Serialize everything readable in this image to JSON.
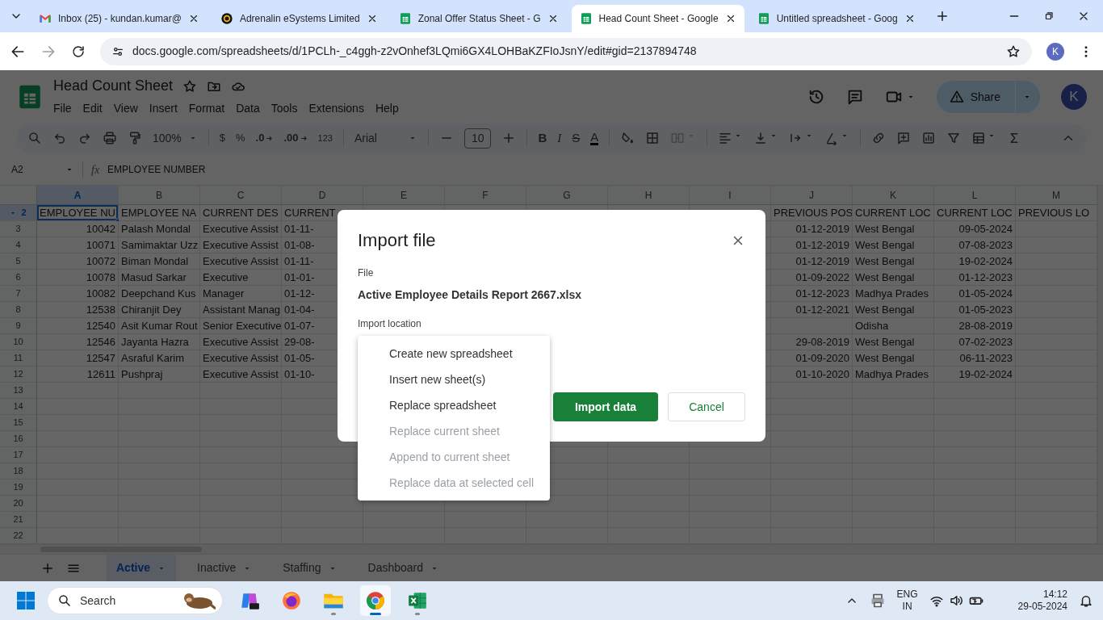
{
  "browser": {
    "tabs": [
      {
        "title": "Inbox (25) - kundan.kumar@",
        "kind": "mail",
        "selected": false
      },
      {
        "title": "Adrenalin eSystems Limited",
        "kind": "site",
        "selected": false
      },
      {
        "title": "Zonal Offer Status Sheet - G",
        "kind": "sheet",
        "selected": false
      },
      {
        "title": "Head Count Sheet - Google",
        "kind": "sheet",
        "selected": true
      },
      {
        "title": "Untitled spreadsheet - Goog",
        "kind": "sheet",
        "selected": false
      }
    ],
    "address": "docs.google.com/spreadsheets/d/1PCLh-_c4ggh-z2vOnhef3LQmi6GX4LOHBaKZFIoJsnY/edit#gid=2137894748",
    "profile_initial": "K"
  },
  "app": {
    "title": "Head Count Sheet",
    "menus": [
      "File",
      "Edit",
      "View",
      "Insert",
      "Format",
      "Data",
      "Tools",
      "Extensions",
      "Help"
    ],
    "share": "Share",
    "account_initial": "K"
  },
  "toolbar": {
    "zoom": "100%",
    "currency": "$",
    "percent": "%",
    "decimal_decrease": ".0",
    "decimal_increase": ".00",
    "number_format": "123",
    "font": "Arial",
    "font_size": "10",
    "bold": "B",
    "italic": "I",
    "strikethrough": "S",
    "text_color": "A"
  },
  "formula_bar": {
    "cell": "A2",
    "fx": "fx",
    "content": "EMPLOYEE NUMBER"
  },
  "sheet": {
    "columns": [
      {
        "letter": "A",
        "kind": "number",
        "selected": true
      },
      {
        "letter": "B",
        "kind": "text",
        "selected": false
      },
      {
        "letter": "C",
        "kind": "text",
        "selected": false
      },
      {
        "letter": "D",
        "kind": "text",
        "selected": false
      },
      {
        "letter": "E",
        "kind": "text",
        "selected": false
      },
      {
        "letter": "F",
        "kind": "text",
        "selected": false
      },
      {
        "letter": "G",
        "kind": "text",
        "selected": false
      },
      {
        "letter": "H",
        "kind": "text",
        "selected": false
      },
      {
        "letter": "I",
        "kind": "text",
        "selected": false
      },
      {
        "letter": "J",
        "kind": "number",
        "selected": false
      },
      {
        "letter": "K",
        "kind": "text",
        "selected": false
      },
      {
        "letter": "L",
        "kind": "number",
        "selected": false
      },
      {
        "letter": "M",
        "kind": "text",
        "selected": false
      }
    ],
    "rows": [
      {
        "number": "2",
        "kind": "header",
        "selected": true,
        "cells": {
          "A": "EMPLOYEE NU",
          "B": "EMPLOYEE NA",
          "C": "CURRENT DES",
          "D": "CURRENT",
          "J": "PREVIOUS POS",
          "K": "CURRENT LOC",
          "L": "CURRENT LOC",
          "M": "PREVIOUS LO"
        }
      },
      {
        "number": "3",
        "kind": "data",
        "selected": false,
        "cells": {
          "A": "10042",
          "B": "Palash Mondal",
          "C": "Executive Assist",
          "D": "01-11-",
          "J": "01-12-2019",
          "K": "West Bengal",
          "L": "09-05-2024"
        }
      },
      {
        "number": "4",
        "kind": "data",
        "selected": false,
        "cells": {
          "A": "10071",
          "B": "Samimaktar Uzz",
          "C": "Executive Assist",
          "D": "01-08-",
          "J": "01-12-2019",
          "K": "West Bengal",
          "L": "07-08-2023"
        }
      },
      {
        "number": "5",
        "kind": "data",
        "selected": false,
        "cells": {
          "A": "10072",
          "B": "Biman Mondal",
          "C": "Executive Assist",
          "D": "01-11-",
          "J": "01-12-2019",
          "K": "West Bengal",
          "L": "19-02-2024"
        }
      },
      {
        "number": "6",
        "kind": "data",
        "selected": false,
        "cells": {
          "A": "10078",
          "B": "Masud Sarkar",
          "C": "Executive",
          "D": "01-01-",
          "J": "01-09-2022",
          "K": "West Bengal",
          "L": "01-12-2023"
        }
      },
      {
        "number": "7",
        "kind": "data",
        "selected": false,
        "cells": {
          "A": "10082",
          "B": "Deepchand Kus",
          "C": "Manager",
          "D": "01-12-",
          "J": "01-12-2023",
          "K": "Madhya Prades",
          "L": "01-05-2024"
        }
      },
      {
        "number": "8",
        "kind": "data",
        "selected": false,
        "cells": {
          "A": "12538",
          "B": "Chiranjit Dey",
          "C": "Assistant Manag",
          "D": "01-04-",
          "J": "01-12-2021",
          "K": "West Bengal",
          "L": "01-05-2023"
        }
      },
      {
        "number": "9",
        "kind": "data",
        "selected": false,
        "cells": {
          "A": "12540",
          "B": "Asit Kumar Rout",
          "C": "Senior Executive",
          "D": "01-07-",
          "K": "Odisha",
          "L": "28-08-2019"
        }
      },
      {
        "number": "10",
        "kind": "data",
        "selected": false,
        "cells": {
          "A": "12546",
          "B": "Jayanta Hazra",
          "C": "Executive Assist",
          "D": "29-08-",
          "J": "29-08-2019",
          "K": "West Bengal",
          "L": "07-02-2023"
        }
      },
      {
        "number": "11",
        "kind": "data",
        "selected": false,
        "cells": {
          "A": "12547",
          "B": "Asraful Karim",
          "C": "Executive Assist",
          "D": "01-05-",
          "J": "01-09-2020",
          "K": "West Bengal",
          "L": "06-11-2023"
        }
      },
      {
        "number": "12",
        "kind": "data",
        "selected": false,
        "cells": {
          "A": "12611",
          "B": "Pushpraj",
          "C": "Executive Assist",
          "D": "01-10-",
          "J": "01-10-2020",
          "K": "Madhya Prades",
          "L": "19-02-2024"
        }
      },
      {
        "number": "13",
        "kind": "data",
        "selected": false
      },
      {
        "number": "14",
        "kind": "data",
        "selected": false
      },
      {
        "number": "15",
        "kind": "data",
        "selected": false
      },
      {
        "number": "16",
        "kind": "data",
        "selected": false
      },
      {
        "number": "17",
        "kind": "data",
        "selected": false
      },
      {
        "number": "18",
        "kind": "data",
        "selected": false
      },
      {
        "number": "19",
        "kind": "data",
        "selected": false
      },
      {
        "number": "20",
        "kind": "data",
        "selected": false
      },
      {
        "number": "21",
        "kind": "data",
        "selected": false
      },
      {
        "number": "22",
        "kind": "data",
        "selected": false
      }
    ]
  },
  "sheet_tabs": [
    {
      "label": "Active",
      "selected": true
    },
    {
      "label": "Inactive",
      "selected": false
    },
    {
      "label": "Staffing",
      "selected": false
    },
    {
      "label": "Dashboard",
      "selected": false
    }
  ],
  "dialog": {
    "title": "Import file",
    "file_label": "File",
    "file_name": "Active Employee Details Report 2667.xlsx",
    "location_label": "Import location",
    "options": [
      {
        "label": "Create new spreadsheet",
        "disabled": false
      },
      {
        "label": "Insert new sheet(s)",
        "disabled": false
      },
      {
        "label": "Replace spreadsheet",
        "disabled": false
      },
      {
        "label": "Replace current sheet",
        "disabled": true
      },
      {
        "label": "Append to current sheet",
        "disabled": true
      },
      {
        "label": "Replace data at selected cell",
        "disabled": true
      }
    ],
    "primary_button": "Import data",
    "cancel_button": "Cancel"
  },
  "taskbar": {
    "search": "Search",
    "apps": [
      {
        "kind": "copilot",
        "running": false,
        "selected": false
      },
      {
        "kind": "firefox",
        "running": false,
        "selected": false
      },
      {
        "kind": "explorer",
        "running": true,
        "selected": false
      },
      {
        "kind": "chrome",
        "running": true,
        "selected": true
      },
      {
        "kind": "excel",
        "running": true,
        "selected": false
      }
    ],
    "language": "ENG",
    "region": "IN",
    "time": "14:12",
    "date": "29-05-2024"
  }
}
